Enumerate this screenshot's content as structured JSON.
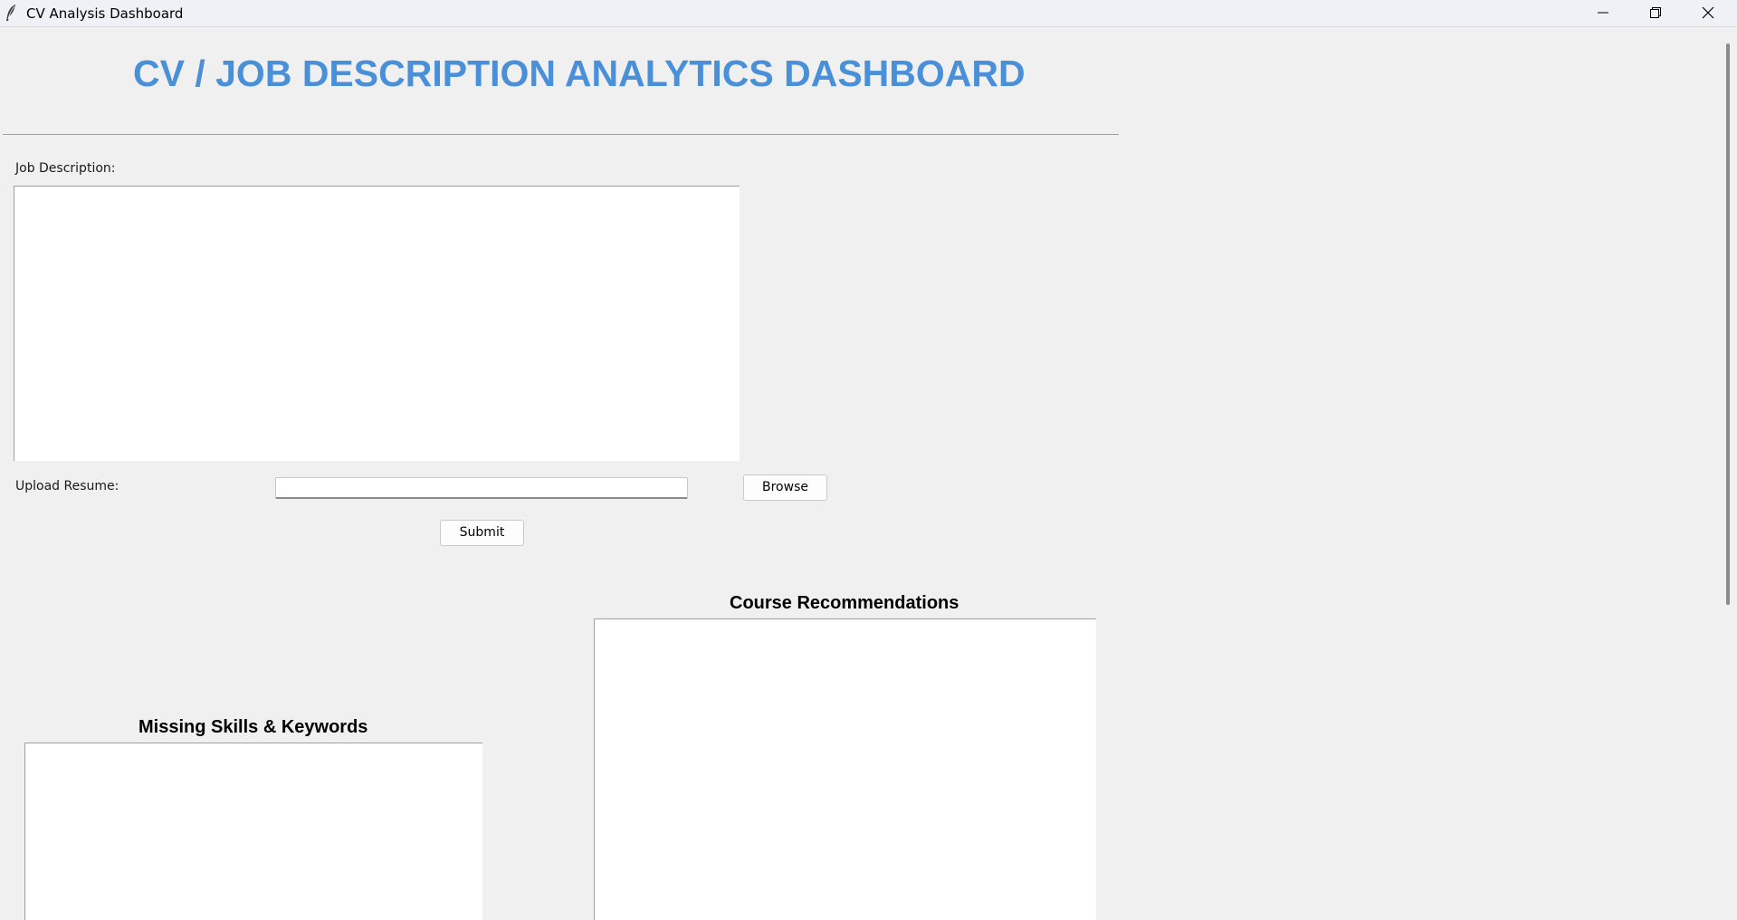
{
  "window": {
    "title": "CV Analysis Dashboard",
    "controls": [
      "minimize",
      "restore",
      "close"
    ]
  },
  "header": {
    "title": "CV / JOB DESCRIPTION ANALYTICS DASHBOARD",
    "title_color": "#4a90d9"
  },
  "form": {
    "job_description_label": "Job Description:",
    "job_description_value": "",
    "upload_resume_label": "Upload Resume:",
    "resume_path_value": "",
    "browse_label": "Browse",
    "submit_label": "Submit"
  },
  "results": {
    "course_recommendations_title": "Course Recommendations",
    "missing_skills_title": "Missing Skills & Keywords"
  }
}
